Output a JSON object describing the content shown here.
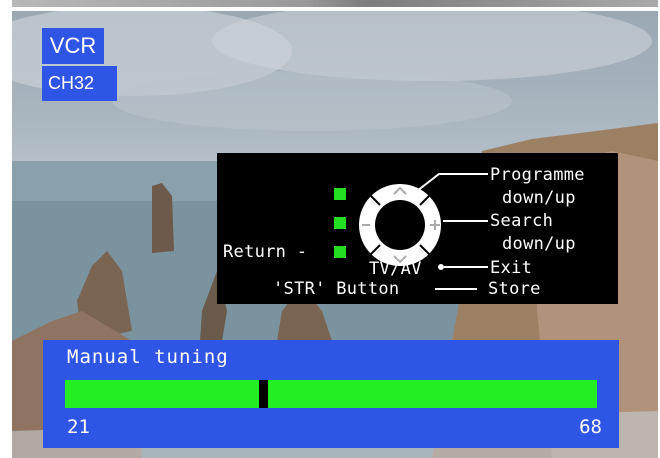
{
  "source_badge": "VCR",
  "channel_badge": "CH32",
  "help_panel": {
    "programme_line1": "Programme",
    "programme_line2": "down/up",
    "search_line1": "Search",
    "search_line2": "down/up",
    "return_label": "Return -",
    "tvav_label": "TV/AV",
    "exit_label": "Exit",
    "str_label": "'STR' Button",
    "store_label": "Store",
    "accent_color": "#22dd22"
  },
  "tuning": {
    "title": "Manual tuning",
    "range_min": "21",
    "range_max": "68",
    "current_fraction": 0.37,
    "bar_color": "#22ee22",
    "panel_color": "#2f55e6"
  }
}
